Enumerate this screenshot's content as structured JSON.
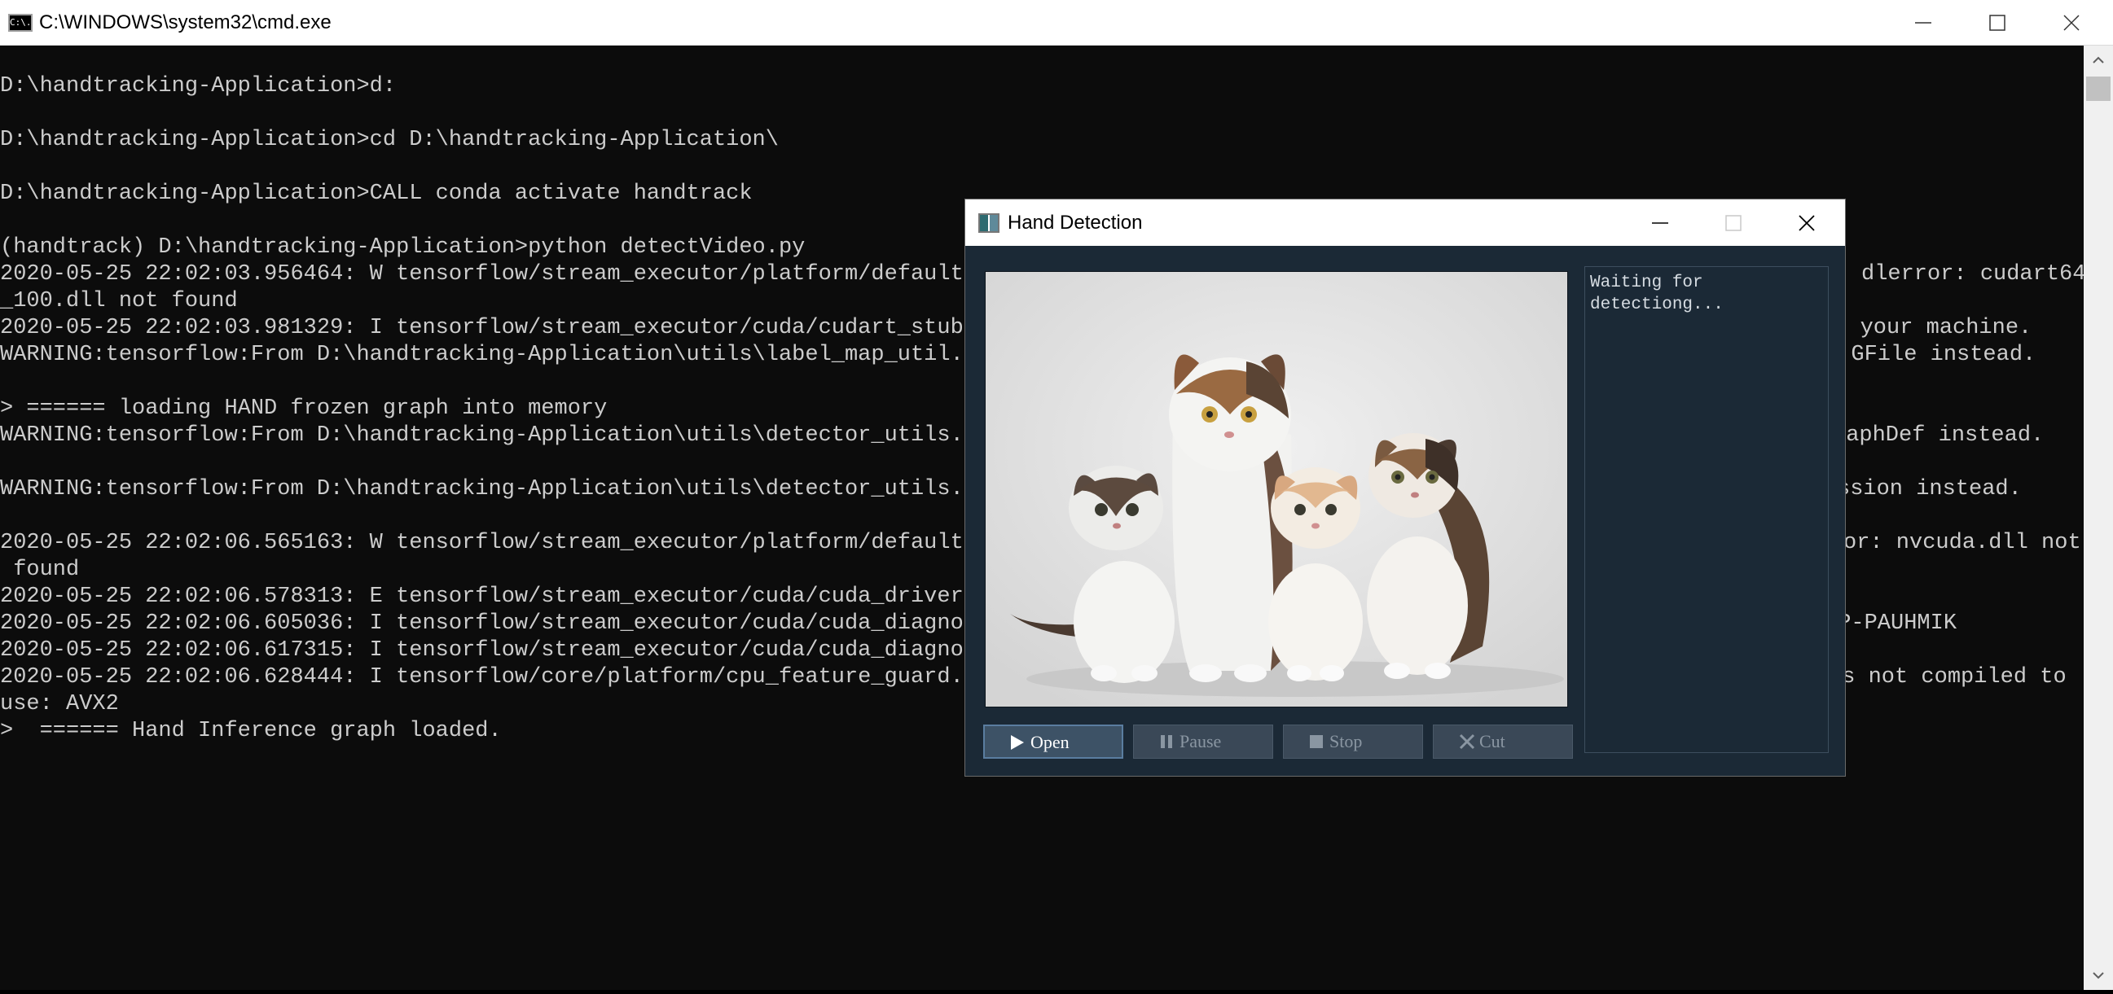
{
  "cmd_window": {
    "title": "C:\\WINDOWS\\system32\\cmd.exe",
    "icon_text": "C:\\.",
    "lines": [
      "D:\\handtracking-Application>d:",
      "D:\\handtracking-Application>cd D:\\handtracking-Application\\",
      "D:\\handtracking-Application>CALL conda activate handtrack",
      "(handtrack) D:\\handtracking-Application>python detectVideo.py",
      "2020-05-25 22:02:03.956464: W tensorflow/stream_executor/platform/default/c",
      "dlerror: cudart64",
      "_100.dll not found",
      "2020-05-25 22:02:03.981329: I tensorflow/stream_executor/cuda/cudart_stub.c",
      "on your machine.",
      "WARNING:tensorflow:From D:\\handtracking-Application\\utils\\label_map_util.py",
      "e.GFile instead.",
      "> ====== loading HAND frozen graph into memory",
      "WARNING:tensorflow:From D:\\handtracking-Application\\utils\\detector_utils.py",
      "raphDef instead.",
      "WARNING:tensorflow:From D:\\handtracking-Application\\utils\\detector_utils.py",
      "ssion instead.",
      "2020-05-25 22:02:06.565163: W tensorflow/stream_executor/platform/default/c",
      "or: nvcuda.dll not",
      " found",
      "2020-05-25 22:02:06.578313: E tensorflow/stream_executor/cuda/cuda_driver.c",
      "2020-05-25 22:02:06.605036: I tensorflow/stream_executor/cuda/cuda_diagnost",
      "OP-PAUHMIK",
      "2020-05-25 22:02:06.617315: I tensorflow/stream_executor/cuda/cuda_diagnost",
      "2020-05-25 22:02:06.628444: I tensorflow/core/platform/cpu_feature_guard.c",
      "as not compiled to",
      "use: AVX2",
      ">  ====== Hand Inference graph loaded."
    ]
  },
  "hand_detection": {
    "title": "Hand Detection",
    "status_text": "Waiting for detectiong...",
    "video_image": "kittens-photo",
    "buttons": [
      {
        "label": "Open",
        "icon": "play-icon",
        "enabled": true
      },
      {
        "label": "Pause",
        "icon": "pause-icon",
        "enabled": false
      },
      {
        "label": "Stop",
        "icon": "stop-icon",
        "enabled": false
      },
      {
        "label": "Cut",
        "icon": "cut-icon",
        "enabled": false
      }
    ]
  },
  "colors": {
    "console_bg": "#0c0c0c",
    "console_text": "#cccccc",
    "app_bg": "#1b2936",
    "button_bg": "#3a4857"
  }
}
